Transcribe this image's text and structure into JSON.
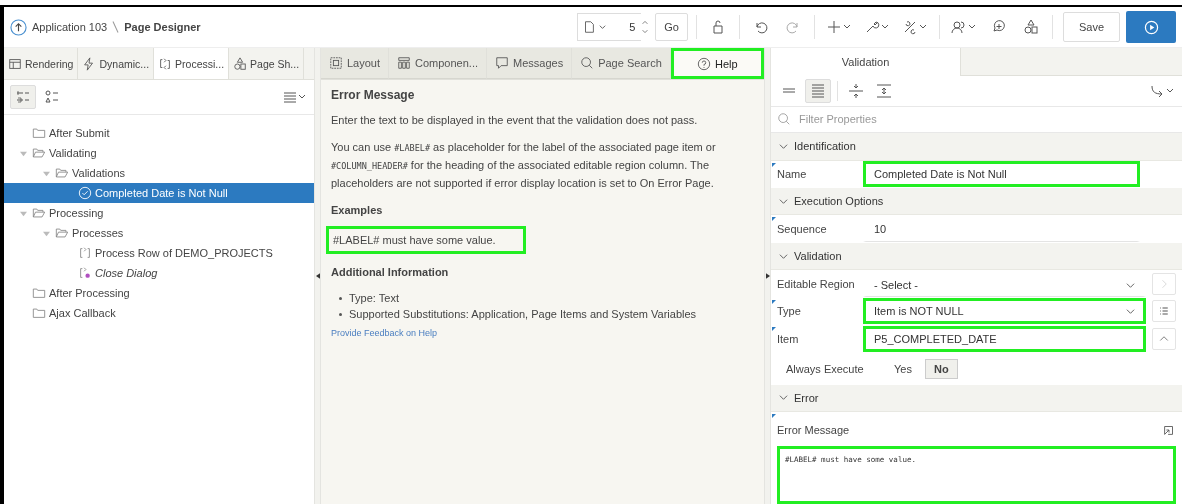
{
  "header": {
    "app_link": "Application 103",
    "page_title": "Page Designer",
    "page_number": "5",
    "go": "Go",
    "save": "Save"
  },
  "left_tabs": [
    {
      "label": "Rendering",
      "selected": false
    },
    {
      "label": "Dynamic...",
      "selected": false
    },
    {
      "label": "Processi...",
      "selected": true
    },
    {
      "label": "Page Sh...",
      "selected": false
    }
  ],
  "tree": [
    {
      "label": "After Submit",
      "kind": "folder",
      "expanded": false,
      "selected": false
    },
    {
      "label": "Validating",
      "kind": "folder",
      "expanded": true,
      "selected": false,
      "children": [
        {
          "label": "Validations",
          "kind": "folder",
          "expanded": true,
          "selected": false,
          "children": [
            {
              "label": "Completed Date is Not Null",
              "kind": "validation",
              "expanded": false,
              "selected": true
            }
          ]
        }
      ]
    },
    {
      "label": "Processing",
      "kind": "folder",
      "expanded": true,
      "selected": false,
      "children": [
        {
          "label": "Processes",
          "kind": "folder",
          "expanded": true,
          "selected": false,
          "children": [
            {
              "label": "Process Row of DEMO_PROJECTS",
              "kind": "process",
              "expanded": false,
              "selected": false
            },
            {
              "label": "Close Dialog",
              "kind": "dialog",
              "expanded": false,
              "selected": false
            }
          ]
        }
      ]
    },
    {
      "label": "After Processing",
      "kind": "folder",
      "expanded": false,
      "selected": false
    },
    {
      "label": "Ajax Callback",
      "kind": "folder",
      "expanded": false,
      "selected": false
    }
  ],
  "middle_tabs": [
    {
      "label": "Layout",
      "selected": false,
      "highlighted": false
    },
    {
      "label": "Componen...",
      "selected": false,
      "highlighted": false
    },
    {
      "label": "Messages",
      "selected": false,
      "highlighted": false
    },
    {
      "label": "Page Search",
      "selected": false,
      "highlighted": false
    },
    {
      "label": "Help",
      "selected": true,
      "highlighted": true
    }
  ],
  "help": {
    "title": "Error Message",
    "intro": "Enter the text to be displayed in the event that the validation does not pass.",
    "paragraph": [
      {
        "text": "You can use ",
        "code": false
      },
      {
        "text": "#LABEL#",
        "code": true
      },
      {
        "text": " as placeholder for the label of the associated page item or ",
        "code": false
      },
      {
        "text": "#COLUMN_HEADER#",
        "code": true
      },
      {
        "text": " for the heading of the associated editable region column. The placeholders are not supported if error display location is set to On Error Page.",
        "code": false
      }
    ],
    "examples_title": "Examples",
    "example": {
      "text": "#LABEL# must have some value.",
      "highlighted": true
    },
    "additional_title": "Additional Information",
    "bullets": [
      "Type: Text",
      "Supported Substitutions: Application, Page Items and System Variables"
    ],
    "feedback_link": "Provide Feedback on Help"
  },
  "properties": {
    "tab": "Validation",
    "filter_placeholder": "Filter Properties",
    "groups": [
      {
        "title": "Identification",
        "rows": [
          {
            "kind": "text",
            "label": "Name",
            "value": "Completed Date is Not Null",
            "required": true,
            "highlighted": true
          }
        ]
      },
      {
        "title": "Execution Options",
        "rows": [
          {
            "kind": "text",
            "label": "Sequence",
            "value": "10",
            "required": true,
            "highlighted": false
          }
        ]
      },
      {
        "title": "Validation",
        "rows": [
          {
            "kind": "select",
            "label": "Editable Region",
            "value": "- Select -",
            "required": false,
            "highlighted": false
          },
          {
            "kind": "select",
            "label": "Type",
            "value": "Item is NOT NULL",
            "required": true,
            "highlighted": true
          },
          {
            "kind": "text",
            "label": "Item",
            "value": "P5_COMPLETED_DATE",
            "required": true,
            "highlighted": true
          },
          {
            "kind": "toggle",
            "label": "Always Execute",
            "options": [
              {
                "label": "Yes",
                "selected": false
              },
              {
                "label": "No",
                "selected": true
              }
            ],
            "required": false,
            "highlighted": false
          }
        ]
      },
      {
        "title": "Error",
        "rows": [
          {
            "kind": "textarea",
            "label": "Error Message",
            "value": "#LABEL# must have some value.",
            "required": true,
            "highlighted": true
          }
        ]
      }
    ]
  }
}
